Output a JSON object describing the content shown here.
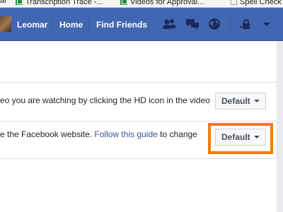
{
  "browser": {
    "bookmarks": [
      {
        "label": "ar",
        "icon": "page-icon"
      },
      {
        "label": "Transcription Trace -...",
        "icon": "sheets-icon"
      },
      {
        "label": "Videos for Approval...",
        "icon": "sheets-icon"
      },
      {
        "label": "Spell Check",
        "icon": "page-icon"
      }
    ]
  },
  "topbar": {
    "user_name": "Leomar",
    "home_label": "Home",
    "find_friends_label": "Find Friends",
    "icons": [
      "friend-requests-icon",
      "messages-icon",
      "notifications-globe-icon",
      "privacy-shortcuts-icon",
      "account-menu-chevron-icon"
    ],
    "color": "#4267b2"
  },
  "settings": {
    "rows": [
      {
        "text": "eo you are watching by clicking the HD icon in the video",
        "dropdown_value": "Default"
      },
      {
        "text_before_link": "e the Facebook website. ",
        "link_text": "Follow this guide",
        "text_after_link": " to change",
        "dropdown_value": "Default",
        "highlighted": true,
        "highlight_color": "#f57c00"
      }
    ]
  }
}
